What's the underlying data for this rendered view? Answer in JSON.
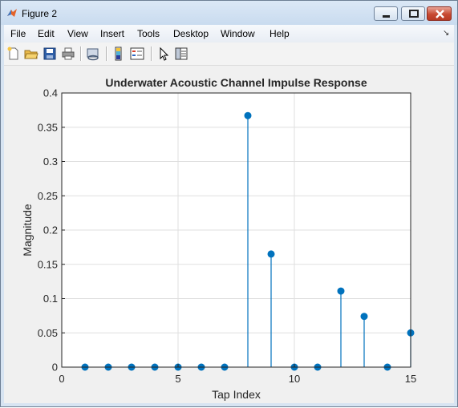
{
  "window": {
    "title": "Figure 2",
    "icon": "matlab-icon",
    "controls": [
      "minimize-icon",
      "maximize-icon",
      "close-icon"
    ]
  },
  "menubar": {
    "items": [
      "File",
      "Edit",
      "View",
      "Insert",
      "Tools",
      "Desktop",
      "Window",
      "Help"
    ],
    "overflow_icon": "menu-dock-arrow-icon"
  },
  "toolbar": {
    "buttons": [
      "new-figure-icon",
      "open-file-icon",
      "save-icon",
      "print-icon",
      "link-plot-icon",
      "insert-colorbar-icon",
      "insert-legend-icon",
      "edit-plot-arrow-icon",
      "property-inspector-icon"
    ]
  },
  "colors": {
    "stem": "#0072bd",
    "grid": "#dfdfdf",
    "axes_bg": "#ffffff",
    "figure_bg": "#f0f0f0",
    "close_button": "#c74a32"
  },
  "chart_data": {
    "type": "stem",
    "title": "Underwater Acoustic Channel Impulse Response",
    "xlabel": "Tap Index",
    "ylabel": "Magnitude",
    "xlim": [
      0,
      15
    ],
    "ylim": [
      0,
      0.4
    ],
    "xticks": [
      "0",
      "5",
      "10",
      "15"
    ],
    "yticks": [
      "0",
      "0.05",
      "0.1",
      "0.15",
      "0.2",
      "0.25",
      "0.3",
      "0.35",
      "0.4"
    ],
    "grid": true,
    "x": [
      1,
      2,
      3,
      4,
      5,
      6,
      7,
      8,
      9,
      10,
      11,
      12,
      13,
      14,
      15
    ],
    "y": [
      0,
      0,
      0,
      0,
      0,
      0,
      0,
      0.367,
      0.165,
      0,
      0,
      0.111,
      0.074,
      0,
      0.05
    ]
  }
}
